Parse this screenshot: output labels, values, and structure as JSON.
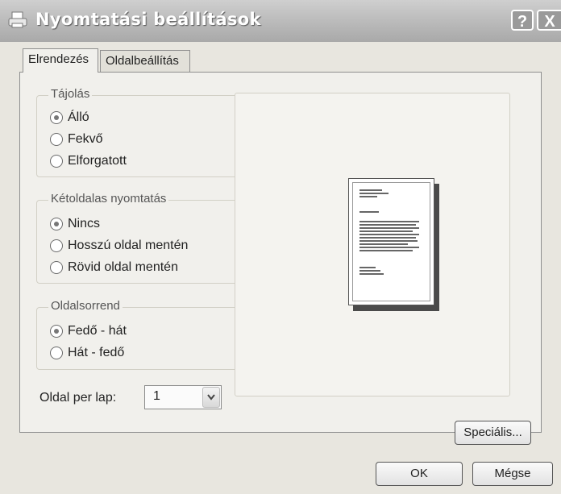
{
  "window": {
    "title": "Nyomtatási beállítások",
    "help_label": "?",
    "close_label": "X"
  },
  "tabs": [
    {
      "label": "Elrendezés",
      "active": true
    },
    {
      "label": "Oldalbeállítás",
      "active": false
    }
  ],
  "orientation": {
    "legend": "Tájolás",
    "options": [
      {
        "label": "Álló",
        "checked": true
      },
      {
        "label": "Fekvő",
        "checked": false
      },
      {
        "label": "Elforgatott",
        "checked": false
      }
    ]
  },
  "duplex": {
    "legend": "Kétoldalas nyomtatás",
    "options": [
      {
        "label": "Nincs",
        "checked": true
      },
      {
        "label": "Hosszú oldal mentén",
        "checked": false
      },
      {
        "label": "Rövid oldal mentén",
        "checked": false
      }
    ]
  },
  "page_order": {
    "legend": "Oldalsorrend",
    "options": [
      {
        "label": "Fedő - hát",
        "checked": true
      },
      {
        "label": "Hát - fedő",
        "checked": false
      }
    ]
  },
  "pages_per_sheet": {
    "label": "Oldal per lap:",
    "value": "1"
  },
  "buttons": {
    "advanced": "Speciális...",
    "ok": "OK",
    "cancel": "Mégse"
  },
  "colors": {
    "title_text": "#ffffff",
    "panel_bg": "#f1f0ec",
    "dialog_bg": "#e8e6df"
  }
}
